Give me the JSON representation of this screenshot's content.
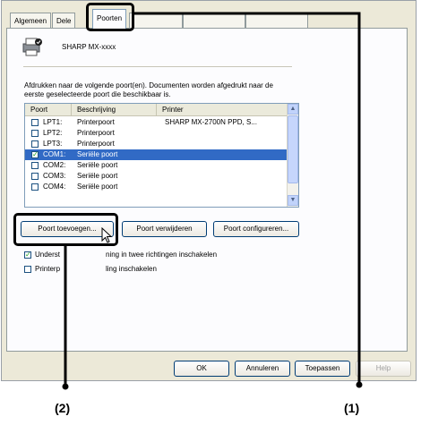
{
  "tabs": [
    {
      "label": "Algemeen"
    },
    {
      "label": "Dele"
    },
    {
      "label": "Poorten"
    }
  ],
  "printer_name": "SHARP MX-xxxx",
  "description": "Afdrukken naar de volgende poort(en). Documenten worden afgedrukt naar de eerste geselecteerde poort die beschikbaar is.",
  "ports_list": {
    "headers": [
      "Poort",
      "Beschrijving",
      "Printer"
    ],
    "rows": [
      {
        "port": "LPT1:",
        "desc": "Printerpoort",
        "printer": "SHARP MX-2700N PPD, S...",
        "checked": false,
        "selected": false
      },
      {
        "port": "LPT2:",
        "desc": "Printerpoort",
        "printer": "",
        "checked": false,
        "selected": false
      },
      {
        "port": "LPT3:",
        "desc": "Printerpoort",
        "printer": "",
        "checked": false,
        "selected": false
      },
      {
        "port": "COM1:",
        "desc": "Seriële poort",
        "printer": "",
        "checked": true,
        "selected": true
      },
      {
        "port": "COM2:",
        "desc": "Seriële poort",
        "printer": "",
        "checked": false,
        "selected": false
      },
      {
        "port": "COM3:",
        "desc": "Seriële poort",
        "printer": "",
        "checked": false,
        "selected": false
      },
      {
        "port": "COM4:",
        "desc": "Seriële poort",
        "printer": "",
        "checked": false,
        "selected": false
      }
    ]
  },
  "port_buttons": {
    "add": "Poort toevoegen...",
    "remove": "Poort verwijderen",
    "configure": "Poort configureren..."
  },
  "options": {
    "bidirectional": {
      "label_a": "Underst",
      "label_b": "ning in twee richtingen inschakelen",
      "checked": true
    },
    "pooling": {
      "label_a": "Printerp",
      "label_b": "ling inschakelen",
      "checked": false
    }
  },
  "dialog_buttons": {
    "ok": "OK",
    "cancel": "Annuleren",
    "apply": "Toepassen",
    "help": "Help"
  },
  "callouts": {
    "one": "(1)",
    "two": "(2)"
  }
}
